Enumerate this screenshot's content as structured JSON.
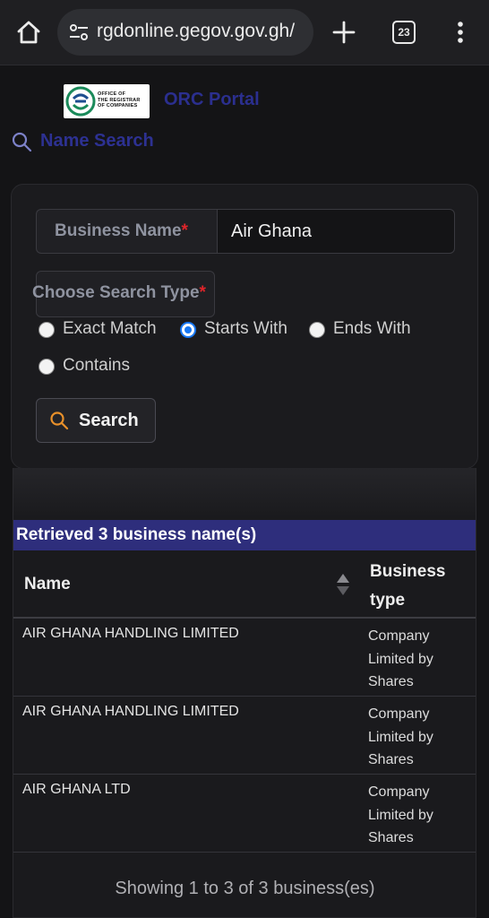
{
  "browser": {
    "url": "rgdonline.gegov.gov.gh/",
    "tab_count": "23"
  },
  "header": {
    "logo_text_lines": [
      "OFFICE OF",
      "THE REGISTRAR",
      "OF COMPANIES"
    ],
    "portal_title": "ORC Portal",
    "section_title": "Name Search"
  },
  "form": {
    "business_name_label": "Business Name",
    "required_mark": "*",
    "business_name_value": "Air Ghana",
    "search_type_label": "Choose Search Type",
    "options": [
      "Exact Match",
      "Starts With",
      "Ends With",
      "Contains"
    ],
    "selected_option": "Starts With",
    "search_button": "Search"
  },
  "results": {
    "banner": "Retrieved 3 business name(s)",
    "columns": [
      "Name",
      "Business type"
    ],
    "rows": [
      {
        "name": "AIR GHANA HANDLING LIMITED",
        "type": "Company Limited by Shares"
      },
      {
        "name": "AIR GHANA HANDLING LIMITED",
        "type": "Company Limited by Shares"
      },
      {
        "name": "AIR GHANA LTD",
        "type": "Company Limited by Shares"
      }
    ],
    "summary": "Showing 1 to 3 of 3 business(es)"
  },
  "colors": {
    "accent": "#2d3192",
    "banner": "#2e2e7c",
    "required": "#e0252a",
    "radio_selected": "#1877f2",
    "search_icon": "#e8902a"
  },
  "icons": [
    "home-icon",
    "tune-icon",
    "plus-icon",
    "tabs-icon",
    "kebab-menu-icon",
    "search-icon",
    "sort-icon"
  ]
}
